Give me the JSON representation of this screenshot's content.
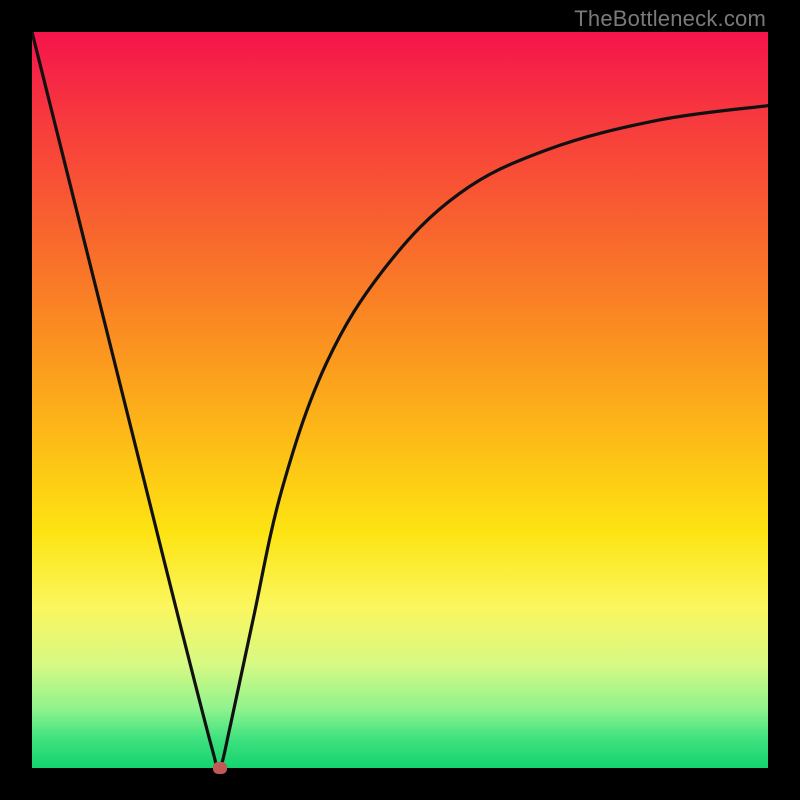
{
  "watermark": "TheBottleneck.com",
  "colors": {
    "frame_bg": "#000000",
    "curve": "#111111",
    "marker": "#c05a57"
  },
  "chart_data": {
    "type": "line",
    "title": "",
    "xlabel": "",
    "ylabel": "",
    "xlim": [
      0,
      100
    ],
    "ylim": [
      0,
      100
    ],
    "gradient_note": "Background gradient encodes bottleneck severity: red (high) at top to green (low) at bottom",
    "series": [
      {
        "name": "curve",
        "x": [
          0,
          5,
          10,
          15,
          20,
          24.5,
          25.5,
          27,
          30,
          34,
          40,
          48,
          58,
          70,
          85,
          100
        ],
        "y": [
          100,
          80,
          60,
          40,
          20,
          2.5,
          0,
          6,
          20,
          38,
          55,
          68,
          78,
          84,
          88,
          90
        ]
      }
    ],
    "marker": {
      "x": 25.5,
      "y": 0
    }
  }
}
